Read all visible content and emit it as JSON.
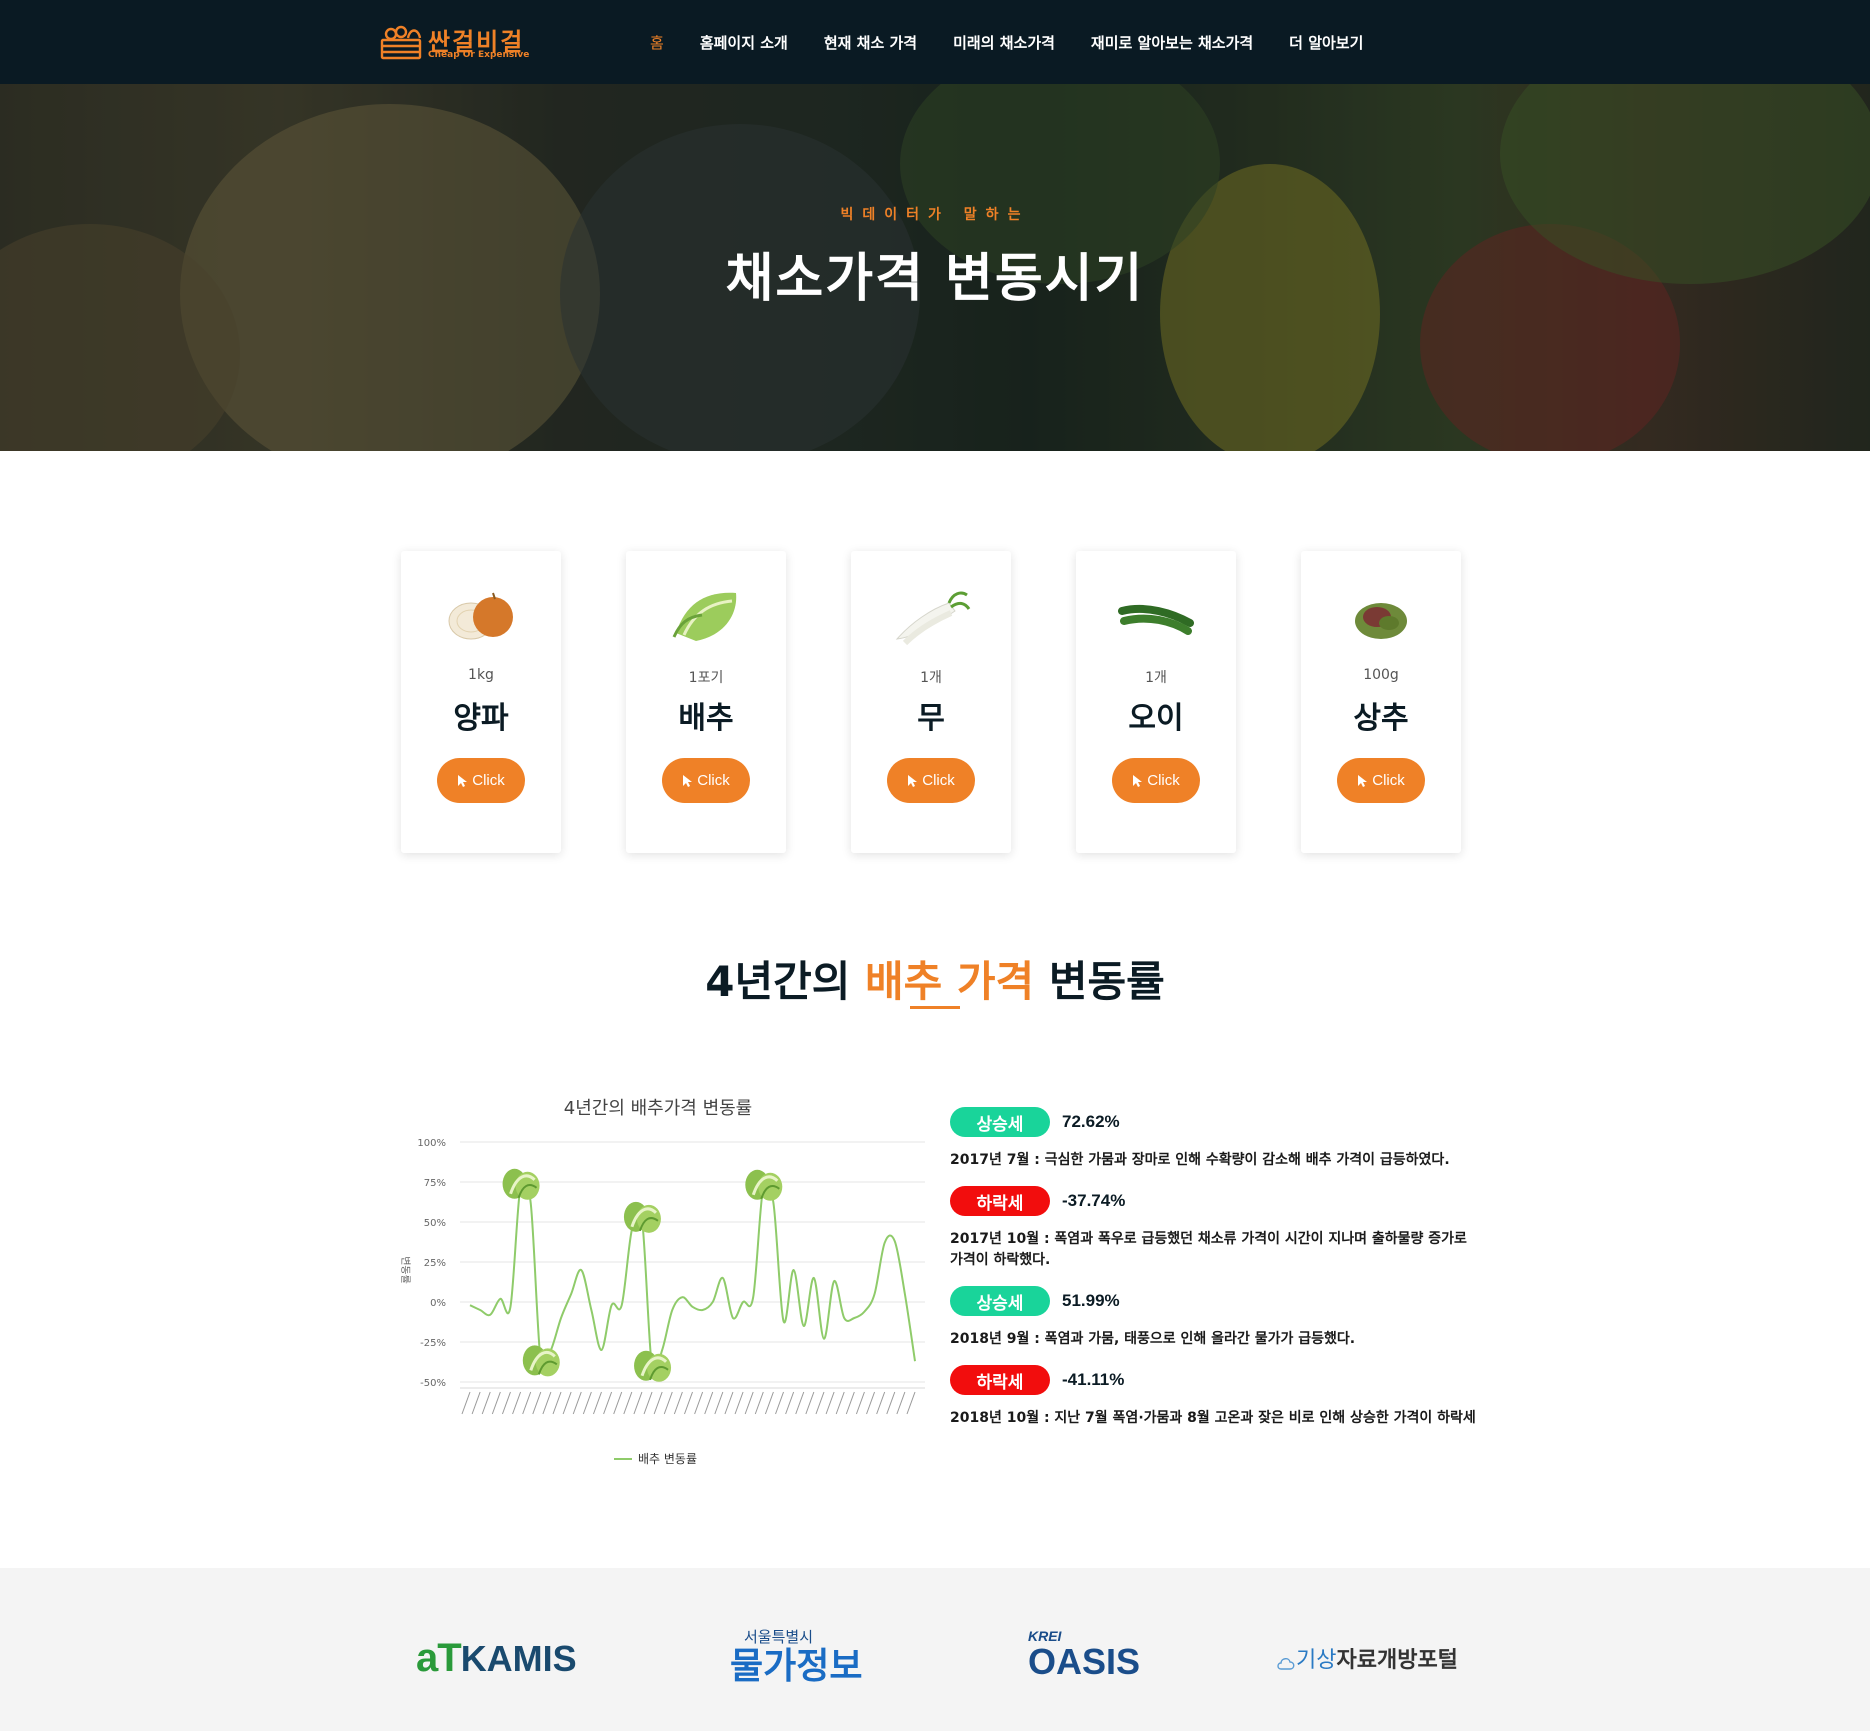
{
  "nav": {
    "logo_main": "싼걸비걸",
    "logo_sub": "Cheap Or Expensive",
    "items": [
      {
        "label": "홈",
        "active": true
      },
      {
        "label": "홈페이지 소개",
        "active": false
      },
      {
        "label": "현재 채소 가격",
        "active": false
      },
      {
        "label": "미래의 채소가격",
        "active": false
      },
      {
        "label": "재미로 알아보는 채소가격",
        "active": false
      },
      {
        "label": "더 알아보기",
        "active": false
      }
    ]
  },
  "hero": {
    "subtitle": "빅데이터가 말하는",
    "title": "채소가격 변동시기"
  },
  "cards": [
    {
      "unit": "1kg",
      "name": "양파",
      "button": "Click",
      "icon": "onion-icon"
    },
    {
      "unit": "1포기",
      "name": "배추",
      "button": "Click",
      "icon": "cabbage-icon"
    },
    {
      "unit": "1개",
      "name": "무",
      "button": "Click",
      "icon": "radish-icon"
    },
    {
      "unit": "1개",
      "name": "오이",
      "button": "Click",
      "icon": "cucumber-icon"
    },
    {
      "unit": "100g",
      "name": "상추",
      "button": "Click",
      "icon": "lettuce-icon"
    }
  ],
  "section": {
    "title_pre": "4년간의 ",
    "title_hl": "배추 가격",
    "title_post": " 변동률"
  },
  "chart_data": {
    "type": "line",
    "title": "4년간의 배추가격 변동률",
    "ylabel": "변동률",
    "yticks": [
      "100%",
      "75%",
      "50%",
      "25%",
      "0%",
      "-25%",
      "-50%"
    ],
    "ylim": [
      -50,
      100
    ],
    "grid": true,
    "legend_position": "bottom",
    "series": [
      {
        "name": "배추 변동률",
        "color": "#8fcb6a",
        "values": [
          -2,
          -5,
          -8,
          2,
          -3,
          72.62,
          62,
          -37.74,
          -30,
          -10,
          5,
          20,
          -5,
          -30,
          -2,
          -2,
          45,
          51.99,
          -41.11,
          -30,
          -5,
          3,
          -3,
          -5,
          0,
          15,
          -10,
          0,
          3,
          72,
          62,
          -12,
          20,
          -15,
          15,
          -23,
          13,
          -10,
          -10,
          -6,
          5,
          37,
          38,
          5,
          -37
        ]
      }
    ],
    "markers": [
      {
        "index": 5,
        "direction": "up"
      },
      {
        "index": 7,
        "direction": "down"
      },
      {
        "index": 17,
        "direction": "up"
      },
      {
        "index": 18,
        "direction": "down"
      },
      {
        "index": 29,
        "direction": "up"
      }
    ]
  },
  "events": [
    {
      "badge": "상승세",
      "badge_color": "#19d49a",
      "pct": "72.62%",
      "text": "2017년 7월 : 극심한 가뭄과 장마로 인해 수확량이 감소해 배추 가격이 급등하였다."
    },
    {
      "badge": "하락세",
      "badge_color": "#f20d0d",
      "pct": "-37.74%",
      "text": "2017년 10월 : 폭염과 폭우로 급등했던 채소류 가격이 시간이 지나며 출하물량 증가로 가격이 하락했다."
    },
    {
      "badge": "상승세",
      "badge_color": "#19d49a",
      "pct": "51.99%",
      "text": "2018년 9월 : 폭염과 가뭄, 태풍으로 인해 올라간 물가가 급등했다."
    },
    {
      "badge": "하락세",
      "badge_color": "#f20d0d",
      "pct": "-41.11%",
      "text": "2018년 10월 : 지난 7월 폭염·가뭄과 8월 고온과 잦은 비로 인해 상승한 가격이 하락세"
    }
  ],
  "footer": {
    "logos": [
      {
        "name": "aTKAMIS",
        "text1": "aT",
        "text2": "KAMIS"
      },
      {
        "name": "서울특별시 물가정보",
        "text1": "서울특별시",
        "text2": "물가정보"
      },
      {
        "name": "KREI OASIS",
        "text1": "KREI",
        "text2": "OASIS"
      },
      {
        "name": "기상자료개방포털",
        "text1": "기상",
        "text2": "자료개방포털"
      }
    ]
  }
}
